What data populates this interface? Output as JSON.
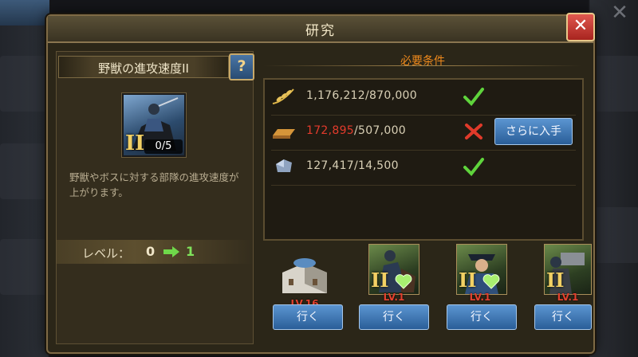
{
  "dialog": {
    "title": "研究",
    "close_symbol": "✕"
  },
  "research": {
    "name": "野獣の進攻速度II",
    "help_symbol": "?",
    "roman": "II",
    "progress": "0/5",
    "description": "野獣やボスに対する部隊の進攻速度が上がります。",
    "level_label": "レベル：",
    "level_current": "0",
    "level_next": "1"
  },
  "requirements": {
    "header": "必要条件",
    "rows": [
      {
        "icon": "grain-icon",
        "have": "1,176,212",
        "need": "/870,000",
        "status": "met"
      },
      {
        "icon": "iron-bar-icon",
        "have": "172,895",
        "need": "/507,000",
        "status": "unmet",
        "button": "さらに入手"
      },
      {
        "icon": "stone-icon",
        "have": "127,417",
        "need": "/14,500",
        "status": "met"
      }
    ]
  },
  "prereqs": [
    {
      "kind": "building",
      "level": "LV.16",
      "button": "行く"
    },
    {
      "kind": "troop",
      "roman": "II",
      "level": "LV.1",
      "button": "行く"
    },
    {
      "kind": "troop",
      "roman": "II",
      "level": "LV.1",
      "button": "行く"
    },
    {
      "kind": "troop",
      "roman": "II",
      "level": "LV.1",
      "button": "行く"
    }
  ],
  "colors": {
    "accent_orange": "#f08a1c",
    "short_red": "#e33b2c",
    "ok_green": "#7fe25b",
    "button_blue": "#3d78b6"
  }
}
